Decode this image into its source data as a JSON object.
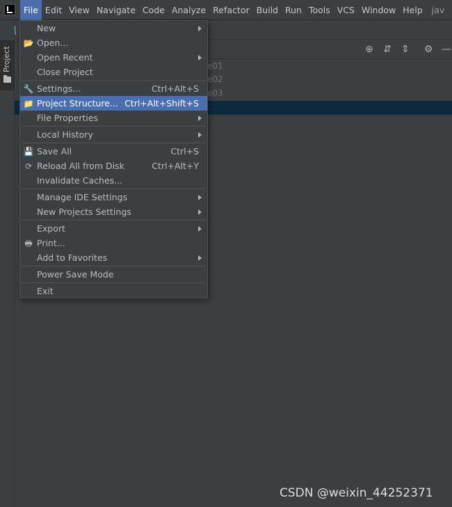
{
  "menubar": {
    "items": [
      {
        "label": "File",
        "key": "file"
      },
      {
        "label": "Edit",
        "key": "edit"
      },
      {
        "label": "View",
        "key": "view"
      },
      {
        "label": "Navigate",
        "key": "navigate"
      },
      {
        "label": "Code",
        "key": "code"
      },
      {
        "label": "Analyze",
        "key": "analyze"
      },
      {
        "label": "Refactor",
        "key": "refactor"
      },
      {
        "label": "Build",
        "key": "build"
      },
      {
        "label": "Run",
        "key": "run"
      },
      {
        "label": "Tools",
        "key": "tools"
      },
      {
        "label": "VCS",
        "key": "vcs"
      },
      {
        "label": "Window",
        "key": "window"
      },
      {
        "label": "Help",
        "key": "help"
      }
    ],
    "title_fragment": "jav"
  },
  "tool_window": {
    "project_tab_label": "Project"
  },
  "tree": {
    "rows": [
      "e01",
      "e02",
      "e03"
    ]
  },
  "file_menu": {
    "items": [
      {
        "label": "New",
        "shortcut": "",
        "submenu": true,
        "icon": ""
      },
      {
        "label": "Open...",
        "shortcut": "",
        "submenu": false,
        "icon": "folder-open-icon"
      },
      {
        "label": "Open Recent",
        "shortcut": "",
        "submenu": true,
        "icon": ""
      },
      {
        "label": "Close Project",
        "shortcut": "",
        "submenu": false,
        "icon": ""
      },
      {
        "label": "Settings...",
        "shortcut": "Ctrl+Alt+S",
        "submenu": false,
        "icon": "wrench-icon"
      },
      {
        "label": "Project Structure...",
        "shortcut": "Ctrl+Alt+Shift+S",
        "submenu": false,
        "icon": "project-structure-icon"
      },
      {
        "label": "File Properties",
        "shortcut": "",
        "submenu": true,
        "icon": ""
      },
      {
        "label": "Local History",
        "shortcut": "",
        "submenu": true,
        "icon": ""
      },
      {
        "label": "Save All",
        "shortcut": "Ctrl+S",
        "submenu": false,
        "icon": "save-icon"
      },
      {
        "label": "Reload All from Disk",
        "shortcut": "Ctrl+Alt+Y",
        "submenu": false,
        "icon": "reload-icon"
      },
      {
        "label": "Invalidate Caches...",
        "shortcut": "",
        "submenu": false,
        "icon": ""
      },
      {
        "label": "Manage IDE Settings",
        "shortcut": "",
        "submenu": true,
        "icon": ""
      },
      {
        "label": "New Projects Settings",
        "shortcut": "",
        "submenu": true,
        "icon": ""
      },
      {
        "label": "Export",
        "shortcut": "",
        "submenu": true,
        "icon": ""
      },
      {
        "label": "Print...",
        "shortcut": "",
        "submenu": false,
        "icon": "print-icon"
      },
      {
        "label": "Add to Favorites",
        "shortcut": "",
        "submenu": true,
        "icon": ""
      },
      {
        "label": "Power Save Mode",
        "shortcut": "",
        "submenu": false,
        "icon": ""
      },
      {
        "label": "Exit",
        "shortcut": "",
        "submenu": false,
        "icon": ""
      }
    ],
    "highlighted_index": 5
  },
  "colors": {
    "background": "#3c3f41",
    "highlight": "#4b6eaf",
    "selection": "#0d293e"
  },
  "watermark": "CSDN @weixin_44252371"
}
